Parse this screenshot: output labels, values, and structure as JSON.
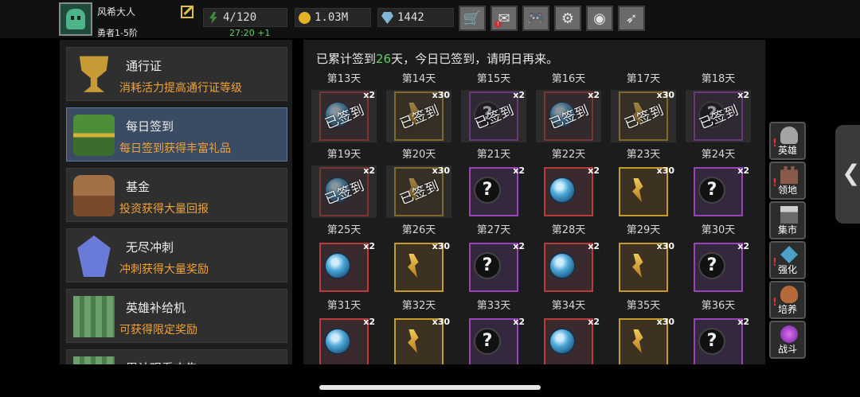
{
  "player": {
    "name": "风希大人",
    "rank": "勇者1-5阶",
    "regen": "27:20 +1"
  },
  "resources": [
    {
      "icon": "energy-icon",
      "value": "4/120"
    },
    {
      "icon": "gold-coin-icon",
      "value": "1.03M"
    },
    {
      "icon": "gem-icon",
      "value": "1442"
    }
  ],
  "toolbar": [
    {
      "icon": "shop-cart-icon",
      "glyph": "🛒",
      "badge": ""
    },
    {
      "icon": "mail-icon",
      "glyph": "✉",
      "badge": "!"
    },
    {
      "icon": "gamepad-icon",
      "glyph": "🎮",
      "badge": ""
    },
    {
      "icon": "gear-icon",
      "glyph": "⚙",
      "badge": ""
    },
    {
      "icon": "color-wheel-icon",
      "glyph": "◉",
      "badge": ""
    },
    {
      "icon": "feather-icon",
      "glyph": "➶",
      "badge": ""
    }
  ],
  "menu": [
    {
      "title": "通行证",
      "desc": "消耗活力提高通行证等级",
      "icon": "trophy-icon",
      "active": false
    },
    {
      "title": "每日签到",
      "desc": "每日签到获得丰富礼品",
      "icon": "treasure-chest-icon",
      "active": true
    },
    {
      "title": "基金",
      "desc": "投资获得大量回报",
      "icon": "money-bag-icon",
      "active": false
    },
    {
      "title": "无尽冲刺",
      "desc": "冲刺获得大量奖励",
      "icon": "crystal-icon",
      "active": false
    },
    {
      "title": "英雄补给机",
      "desc": "可获得限定奖励",
      "icon": "supply-crate-icon",
      "active": false
    },
    {
      "title": "累计观看广告",
      "desc": "",
      "icon": "ad-icon",
      "active": false
    }
  ],
  "signin": {
    "message_prefix": "已累计签到",
    "count": "26",
    "message_suffix": "天，今日已签到，请明日再来。",
    "stamp": "已签到",
    "rows": [
      {
        "labels": [
          "第13天",
          "第14天",
          "第15天",
          "第16天",
          "第17天",
          "第18天"
        ],
        "rewards": [
          {
            "type": "orb",
            "qty": "x2",
            "frame": "red",
            "claimed": true
          },
          {
            "type": "shard",
            "qty": "x30",
            "frame": "gold",
            "claimed": true
          },
          {
            "type": "mystery",
            "qty": "x2",
            "frame": "purple",
            "claimed": true
          },
          {
            "type": "orb",
            "qty": "x2",
            "frame": "red",
            "claimed": true
          },
          {
            "type": "shard",
            "qty": "x30",
            "frame": "gold",
            "claimed": true
          },
          {
            "type": "mystery",
            "qty": "x2",
            "frame": "purple",
            "claimed": true
          }
        ]
      },
      {
        "labels": [
          "第19天",
          "第20天",
          "第21天",
          "第22天",
          "第23天",
          "第24天"
        ],
        "rewards": [
          {
            "type": "orb",
            "qty": "x2",
            "frame": "red",
            "claimed": true
          },
          {
            "type": "shard",
            "qty": "x30",
            "frame": "gold",
            "claimed": true
          },
          {
            "type": "mystery",
            "qty": "x2",
            "frame": "purple",
            "claimed": false
          },
          {
            "type": "orb",
            "qty": "x2",
            "frame": "red",
            "claimed": false
          },
          {
            "type": "shard",
            "qty": "x30",
            "frame": "gold",
            "claimed": false
          },
          {
            "type": "mystery",
            "qty": "x2",
            "frame": "purple",
            "claimed": false
          }
        ]
      },
      {
        "labels": [
          "第25天",
          "第26天",
          "第27天",
          "第28天",
          "第29天",
          "第30天"
        ],
        "rewards": [
          {
            "type": "orb",
            "qty": "x2",
            "frame": "red",
            "claimed": false
          },
          {
            "type": "shard",
            "qty": "x30",
            "frame": "gold",
            "claimed": false
          },
          {
            "type": "mystery",
            "qty": "x2",
            "frame": "purple",
            "claimed": false
          },
          {
            "type": "orb",
            "qty": "x2",
            "frame": "red",
            "claimed": false
          },
          {
            "type": "shard",
            "qty": "x30",
            "frame": "gold",
            "claimed": false
          },
          {
            "type": "mystery",
            "qty": "x2",
            "frame": "purple",
            "claimed": false
          }
        ]
      },
      {
        "labels": [
          "第31天",
          "第32天",
          "第33天",
          "第34天",
          "第35天",
          "第36天"
        ],
        "rewards": [
          {
            "type": "orb",
            "qty": "x2",
            "frame": "red",
            "claimed": false
          },
          {
            "type": "shard",
            "qty": "x30",
            "frame": "gold",
            "claimed": false
          },
          {
            "type": "mystery",
            "qty": "x2",
            "frame": "purple",
            "claimed": false
          },
          {
            "type": "orb",
            "qty": "x2",
            "frame": "red",
            "claimed": false
          },
          {
            "type": "shard",
            "qty": "x30",
            "frame": "gold",
            "claimed": false
          },
          {
            "type": "mystery",
            "qty": "x2",
            "frame": "purple",
            "claimed": false
          }
        ]
      }
    ]
  },
  "dock": [
    {
      "label": "英雄",
      "icon": "hero-helmet-icon",
      "warn": true
    },
    {
      "label": "领地",
      "icon": "castle-icon",
      "warn": true
    },
    {
      "label": "集市",
      "icon": "market-icon",
      "warn": false
    },
    {
      "label": "强化",
      "icon": "upgrade-gem-icon",
      "warn": true
    },
    {
      "label": "培养",
      "icon": "potion-icon",
      "warn": true
    },
    {
      "label": "战斗",
      "icon": "portal-icon",
      "warn": false
    }
  ],
  "sidetab": {
    "glyph": "❮"
  },
  "colors": {
    "accent_green": "#5ed05e",
    "desc_orange": "#f0a33a",
    "active_blue": "#3a4b63"
  }
}
